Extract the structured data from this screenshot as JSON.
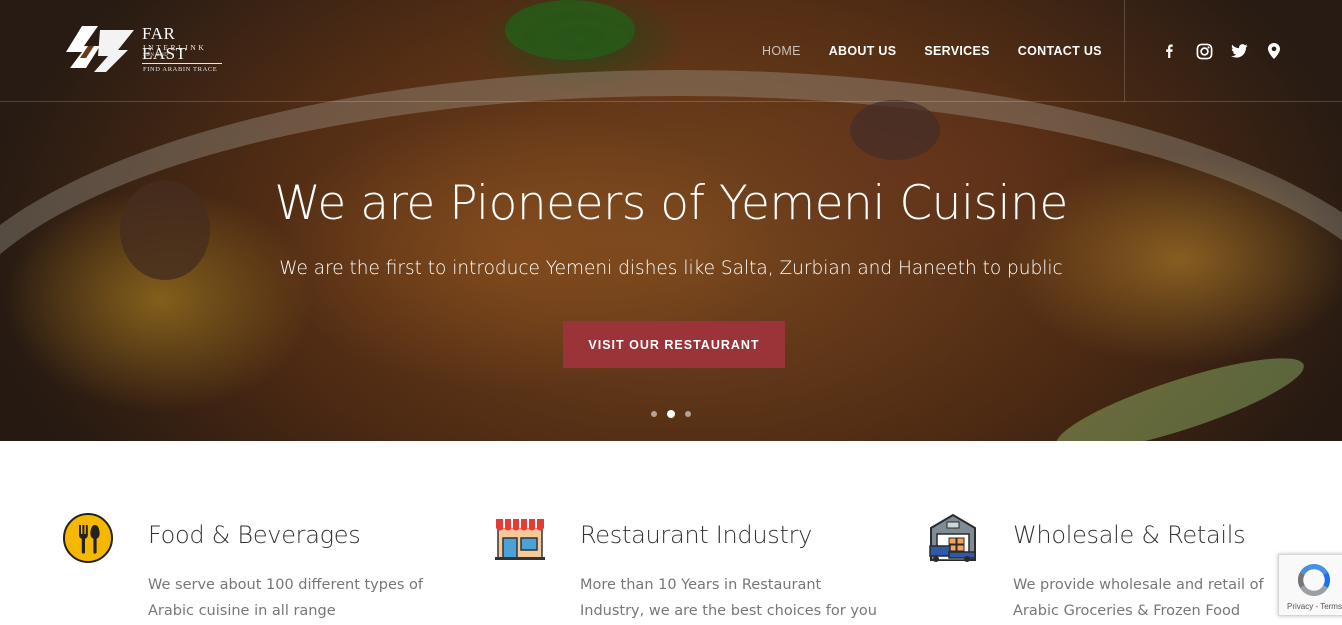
{
  "brand": {
    "name": "FAR EAST",
    "sub": "INTERLINK",
    "sdn": "SDN BHD",
    "tagline": "FIND ARABIN TRACE"
  },
  "nav": {
    "items": [
      {
        "label": "HOME",
        "active": true
      },
      {
        "label": "ABOUT US",
        "active": false
      },
      {
        "label": "SERVICES",
        "active": false
      },
      {
        "label": "CONTACT US",
        "active": false
      }
    ]
  },
  "social": [
    "facebook-icon",
    "instagram-icon",
    "twitter-icon",
    "location-pin-icon"
  ],
  "hero": {
    "title": "We are Pioneers of Yemeni Cuisine",
    "subtitle": "We are the first to introduce Yemeni dishes like Salta, Zurbian and Haneeth to public",
    "button": "VISIT OUR RESTAURANT",
    "slides": 3,
    "active_slide": 2
  },
  "features": [
    {
      "icon": "utensils-icon",
      "title": "Food & Beverages",
      "desc": "We serve about 100 different types of Arabic cuisine in all range"
    },
    {
      "icon": "storefront-icon",
      "title": "Restaurant Industry",
      "desc": "More than 10 Years in Restaurant Industry, we are the best choices for you"
    },
    {
      "icon": "warehouse-truck-icon",
      "title": "Wholesale & Retails",
      "desc": "We provide wholesale and retail of Arabic Groceries & Frozen Food"
    }
  ],
  "recaptcha": {
    "text": "Privacy - Terms"
  },
  "colors": {
    "accent": "#9b3438",
    "heading": "#333333",
    "body": "#777777",
    "icon_yellow": "#f5b700"
  }
}
